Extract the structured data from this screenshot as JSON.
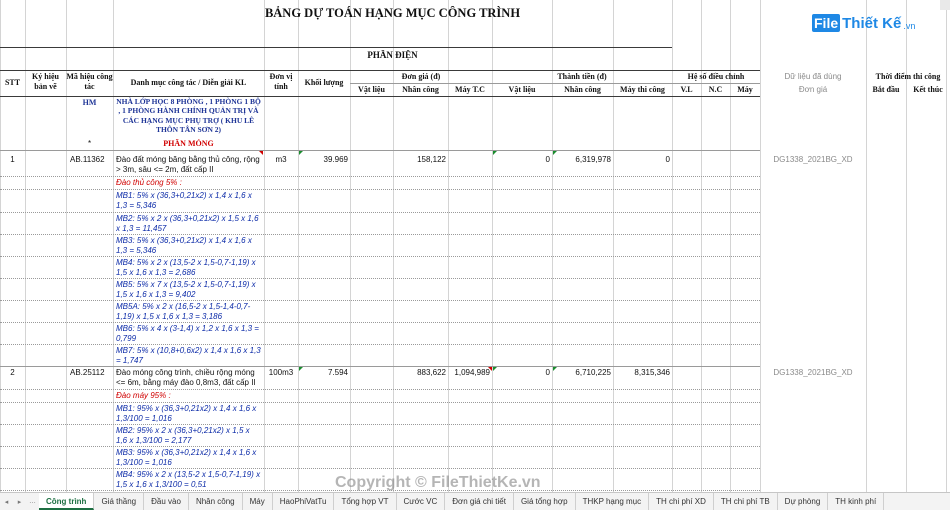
{
  "title": "BẢNG DỰ TOÁN HẠNG MỤC CÔNG TRÌNH",
  "section": "PHẦN ĐIỆN",
  "headers": {
    "stt": "STT",
    "ky_hieu": "Ký hiệu bản vẽ",
    "ma_hieu": "Mã hiệu công tác",
    "danh_muc": "Danh mục công tác / Diễn giải KL",
    "don_vi": "Đơn vị tính",
    "khoi_luong": "Khối lượng",
    "don_gia": "Đơn giá (đ)",
    "thanh_tien": "Thành tiền (đ)",
    "vat_lieu": "Vật liệu",
    "nhan_cong": "Nhân công",
    "may_tc": "Máy T.C",
    "vat_lieu2": "Vật liệu",
    "nhan_cong2": "Nhân công",
    "may_thi_cong": "Máy thi công",
    "he_so": "Hệ số điều chỉnh",
    "vl": "V.L",
    "nc": "N.C",
    "may": "Máy",
    "du_lieu": "Dữ liệu đã dùng",
    "don_gia_ref": "Đơn giá",
    "thoi_diem": "Thời điểm thi công",
    "bat_dau": "Bắt đầu",
    "ket_thuc": "Kết thúc"
  },
  "hm": {
    "code": "HM",
    "name": "NHÀ LỚP HỌC 8 PHÒNG , 1 PHÒNG 1 BỘ , 1 PHÒNG HÀNH CHÍNH QUẢN TRỊ VÀ CÁC HẠNG MỤC PHỤ TRỢ ( KHU LÊ THÔN TÂN SƠN 2)",
    "star": "*",
    "phan_mong": "PHẦN MÓNG"
  },
  "rows": [
    {
      "stt": "1",
      "ma": "AB.11362",
      "desc": "Đào đất móng băng bằng thủ công, rộng > 3m, sâu <= 2m, đất cấp II",
      "unit": "m3",
      "qty": "39.969",
      "nhan_cong": "158,122",
      "tt_vat_lieu": "0",
      "tt_nhan_cong": "6,319,978",
      "tt_may": "0",
      "ref": "DG1338_2021BG_XD",
      "note": "Đào thủ công 5% :",
      "lines": [
        "MB1:  5% x (36,3+0,21x2) x 1,4 x 1,6 x 1,3 = 5,346",
        "MB2:  5% x 2 x (36,3+0,21x2) x 1,5 x 1,6 x 1,3 = 11,457",
        "MB3:  5%  x (36,3+0,21x2) x 1,4 x 1,6 x 1,3 = 5,346",
        "MB4:  5% x 2 x (13,5-2 x 1,5-0,7-1,19) x 1,5 x 1,6 x 1,3 = 2,686",
        "MB5:  5% x 7 x (13,5-2 x 1,5-0,7-1,19) x 1,5 x 1,6 x 1,3 = 9,402",
        "MB5A:  5% x 2 x (16,5-2 x 1,5-1,4-0,7-1,19) x 1,5 x 1,6 x 1,3 = 3,186",
        "MB6:  5% x 4 x (3-1,4) x 1,2 x 1,6 x 1,3 = 0,799",
        "MB7:  5%  x (10,8+0,6x2) x 1,4 x 1,6 x 1,3 = 1,747"
      ]
    },
    {
      "stt": "2",
      "ma": "AB.25112",
      "desc": "Đào móng công trình, chiều rộng móng <= 6m, bằng máy đào 0,8m3, đất cấp II",
      "unit": "100m3",
      "qty": "7.594",
      "nhan_cong": "883,622",
      "may_tc": "1,094,989",
      "tt_vat_lieu": "0",
      "tt_nhan_cong": "6,710,225",
      "tt_may": "8,315,346",
      "ref": "DG1338_2021BG_XD",
      "note": "Đào máy 95% :",
      "lines": [
        "MB1:  95% x (36,3+0,21x2) x 1,4 x 1,6 x 1,3/100 = 1,016",
        "MB2:  95% x 2 x (36,3+0,21x2) x 1,5 x 1,6 x 1,3/100 = 2,177",
        "MB3:  95%  x (36,3+0,21x2) x 1,4 x 1,6 x 1,3/100 = 1,016",
        "MB4:  95% x 2 x (13,5-2 x 1,5-0,7-1,19) x 1,5 x 1,6 x 1,3/100 = 0,51"
      ]
    }
  ],
  "tabs": [
    "Công trình",
    "Giá thầng",
    "Đầu vào",
    "Nhân công",
    "Máy",
    "HaoPhiVatTu",
    "Tổng hợp VT",
    "Cước VC",
    "Đơn giá chi tiết",
    "Giá tổng hợp",
    "THKP hạng mục",
    "TH chi phí XD",
    "TH chi phí TB",
    "Dự phòng",
    "TH kinh phí"
  ],
  "active_tab": "Công trình",
  "logo": {
    "badge": "File",
    "text": "Thiết Kế",
    "suffix": ".vn"
  },
  "watermark": "Copyright © FileThietKe.vn",
  "colors": {
    "accent": "#1d6f42",
    "blue_text": "#0b2aa8",
    "red_text": "#d00000",
    "logo": "#1e88e5"
  }
}
